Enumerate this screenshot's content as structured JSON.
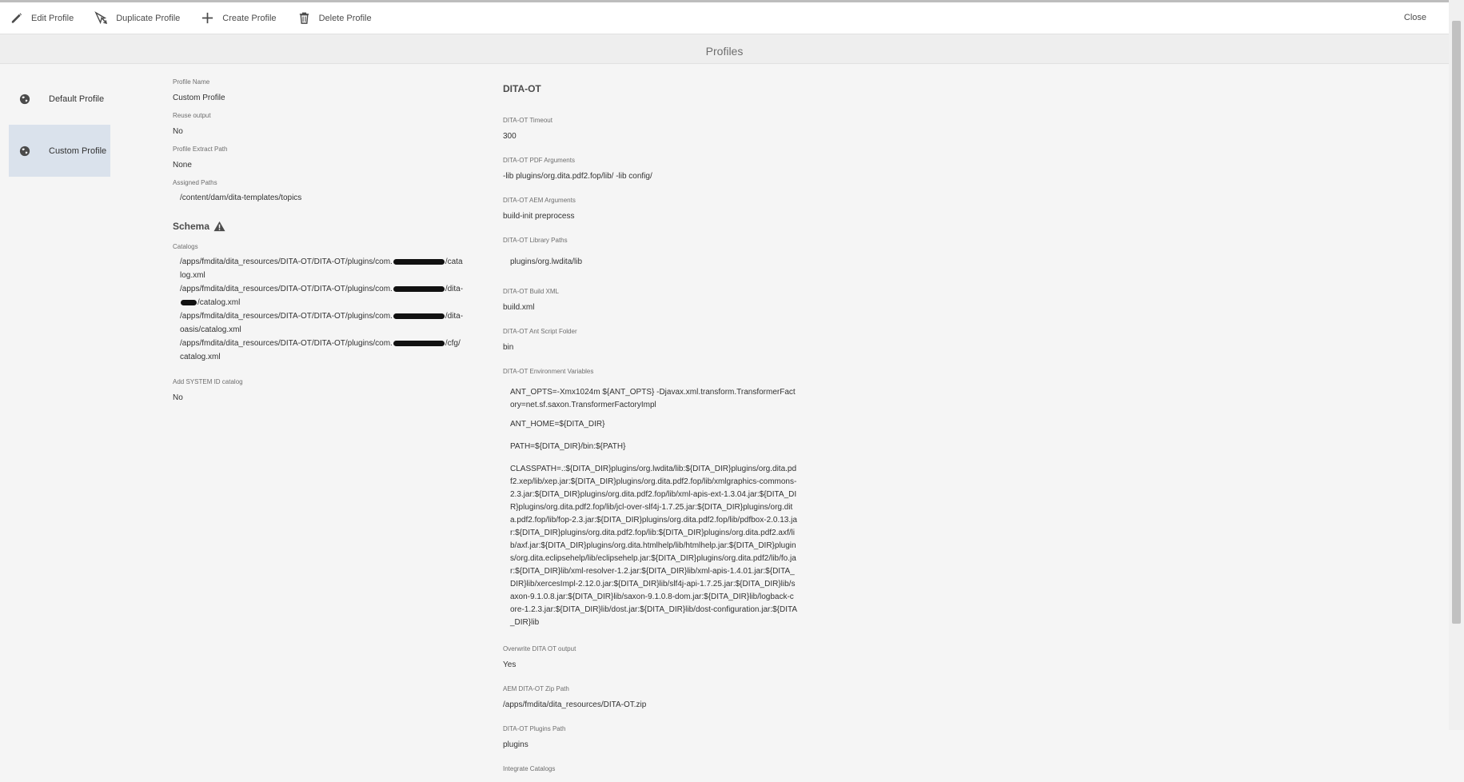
{
  "toolbar": {
    "edit_label": "Edit Profile",
    "duplicate_label": "Duplicate Profile",
    "create_label": "Create Profile",
    "delete_label": "Delete Profile",
    "close_label": "Close"
  },
  "page_title": "Profiles",
  "profiles": [
    {
      "label": "Default Profile",
      "icon": "globe-icon",
      "selected": false
    },
    {
      "label": "Custom Profile",
      "icon": "globe-icon",
      "selected": true
    }
  ],
  "general": {
    "profile_name_label": "Profile Name",
    "profile_name_value": "Custom Profile",
    "reuse_output_label": "Reuse output",
    "reuse_output_value": "No",
    "extract_path_label": "Profile Extract Path",
    "extract_path_value": "None",
    "assigned_paths_label": "Assigned Paths",
    "assigned_paths": [
      "/content/dam/dita-templates/topics"
    ]
  },
  "schema": {
    "heading": "Schema",
    "catalogs_label": "Catalogs",
    "catalogs": [
      {
        "prefix": "/apps/fmdita/dita_resources/DITA-OT/DITA-OT/plugins/com.",
        "suffix": "/catalog.xml"
      },
      {
        "prefix": "/apps/fmdita/dita_resources/DITA-OT/DITA-OT/plugins/com.",
        "suffix": "/dita-",
        "suffix2": "/catalog.xml"
      },
      {
        "prefix": "/apps/fmdita/dita_resources/DITA-OT/DITA-OT/plugins/com.",
        "suffix": "/dita-oasis/catalog.xml"
      },
      {
        "prefix": "/apps/fmdita/dita_resources/DITA-OT/DITA-OT/plugins/com.",
        "suffix": "/cfg/catalog.xml"
      }
    ],
    "system_id_label": "Add SYSTEM ID catalog",
    "system_id_value": "No"
  },
  "ditaot": {
    "heading": "DITA-OT",
    "timeout_label": "DITA-OT Timeout",
    "timeout_value": "300",
    "pdf_args_label": "DITA-OT PDF Arguments",
    "pdf_args_value": "-lib plugins/org.dita.pdf2.fop/lib/ -lib config/",
    "aem_args_label": "DITA-OT AEM Arguments",
    "aem_args_value": "build-init preprocess",
    "library_paths_label": "DITA-OT Library Paths",
    "library_paths": [
      "plugins/org.lwdita/lib"
    ],
    "build_xml_label": "DITA-OT Build XML",
    "build_xml_value": "build.xml",
    "ant_script_label": "DITA-OT Ant Script Folder",
    "ant_script_value": "bin",
    "env_label": "DITA-OT Environment Variables",
    "env_vars": [
      "ANT_OPTS=-Xmx1024m ${ANT_OPTS} -Djavax.xml.transform.TransformerFactory=net.sf.saxon.TransformerFactoryImpl",
      "ANT_HOME=${DITA_DIR}",
      "PATH=${DITA_DIR}/bin:${PATH}",
      "CLASSPATH=.:${DITA_DIR}plugins/org.lwdita/lib:${DITA_DIR}plugins/org.dita.pdf2.xep/lib/xep.jar:${DITA_DIR}plugins/org.dita.pdf2.fop/lib/xmlgraphics-commons-2.3.jar:${DITA_DIR}plugins/org.dita.pdf2.fop/lib/xml-apis-ext-1.3.04.jar:${DITA_DIR}plugins/org.dita.pdf2.fop/lib/jcl-over-slf4j-1.7.25.jar:${DITA_DIR}plugins/org.dita.pdf2.fop/lib/fop-2.3.jar:${DITA_DIR}plugins/org.dita.pdf2.fop/lib/pdfbox-2.0.13.jar:${DITA_DIR}plugins/org.dita.pdf2.fop/lib:${DITA_DIR}plugins/org.dita.pdf2.axf/lib/axf.jar:${DITA_DIR}plugins/org.dita.htmlhelp/lib/htmlhelp.jar:${DITA_DIR}plugins/org.dita.eclipsehelp/lib/eclipsehelp.jar:${DITA_DIR}plugins/org.dita.pdf2/lib/fo.jar:${DITA_DIR}lib/xml-resolver-1.2.jar:${DITA_DIR}lib/xml-apis-1.4.01.jar:${DITA_DIR}lib/xercesImpl-2.12.0.jar:${DITA_DIR}lib/slf4j-api-1.7.25.jar:${DITA_DIR}lib/saxon-9.1.0.8.jar:${DITA_DIR}lib/saxon-9.1.0.8-dom.jar:${DITA_DIR}lib/logback-core-1.2.3.jar:${DITA_DIR}lib/dost.jar:${DITA_DIR}lib/dost-configuration.jar:${DITA_DIR}lib"
    ],
    "overwrite_label": "Overwrite DITA OT output",
    "overwrite_value": "Yes",
    "zip_path_label": "AEM DITA-OT Zip Path",
    "zip_path_value": "/apps/fmdita/dita_resources/DITA-OT.zip",
    "plugins_path_label": "DITA-OT Plugins Path",
    "plugins_path_value": "plugins",
    "integrate_catalogs_label": "Integrate Catalogs"
  }
}
